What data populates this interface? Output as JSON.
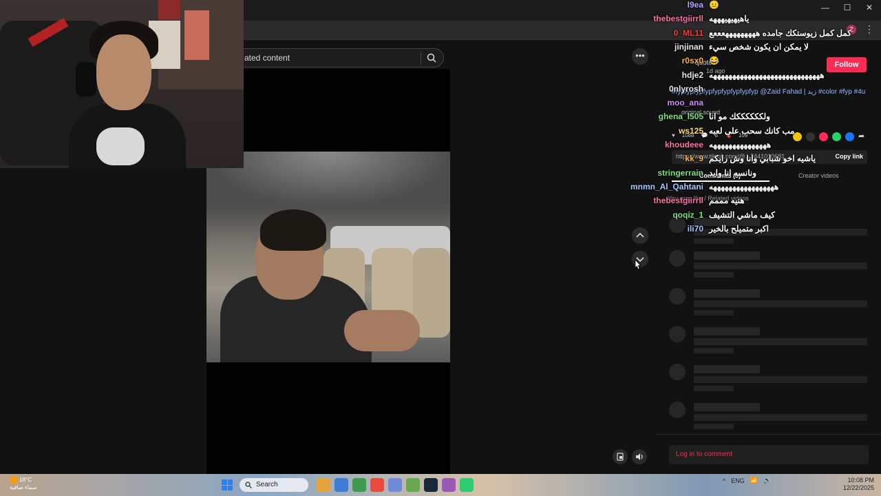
{
  "search": {
    "placeholder_text": "ated content"
  },
  "window": {
    "minimize": "—",
    "maximize": "☐",
    "close": "✕",
    "profile_badge": "Z"
  },
  "panel": {
    "follow_label": "Follow",
    "author_line": "quote",
    "time_line": "1d ago",
    "caption": "#fypfypfypfypfypfypfypfypfyp @Zaid Fahad | زيد #color #fyp #4u",
    "sound": "original sound",
    "likes": "1088",
    "comments_count": "8",
    "saves": "159",
    "copy_url": "https://www.tiktok.com/@...7441030681...",
    "copy_label": "Copy link",
    "tab_comments": "Comments (8)",
    "tab_creator": "Creator videos",
    "related_label": "You may like / Related videos",
    "login_label": "Log in to comment"
  },
  "chat": [
    {
      "user": "l9ea",
      "msg": "😐",
      "color": "#b9a5ff"
    },
    {
      "user": "thebestgiirrll",
      "msg": "ياهيهيهيهههه",
      "color": "#ff6fa8"
    },
    {
      "user": "0_ML11",
      "msg": "كمل كمل زيوستكك جامده هههههههههعععع",
      "color": "#ff3b3b"
    },
    {
      "user": "jinjinan",
      "msg": "لا يمكن ان يكون شخص سيء",
      "color": "#e8e8e8"
    },
    {
      "user": "r0sx0",
      "msg": "😂",
      "color": "#ffb347"
    },
    {
      "user": "hdje2",
      "msg": "هههههههههههههههههههههههههههههه",
      "color": "#e8e8e8"
    },
    {
      "user": "0nlyrosh",
      "msg": "",
      "color": "#e8e8e8"
    },
    {
      "user": "moo_ana",
      "msg": "",
      "color": "#d08bff"
    },
    {
      "user": "ghena_l505",
      "msg": "ولككككككك مو انا",
      "color": "#7ee07e"
    },
    {
      "user": "ws125",
      "msg": "مب كانك سحب على لعبه",
      "color": "#ffe066"
    },
    {
      "user": "khoudeee",
      "msg": "هههههههههههههههه",
      "color": "#ff6fa8"
    },
    {
      "user": "kk_9",
      "msg": "ياشيه اخو شبابي وانا وش رايكم",
      "color": "#ffb347"
    },
    {
      "user": "stringerrain",
      "msg": "ونانسه انا وايد",
      "color": "#7ee07e"
    },
    {
      "user": "mnmn_Al_Qahtani",
      "msg": "هههههههههههههههههه",
      "color": "#a9c7ff"
    },
    {
      "user": "thebestgiirrll",
      "msg": "هنيه مممم",
      "color": "#ff6fa8"
    },
    {
      "user": "qoqiz_1",
      "msg": "كيف ماشي التشيف",
      "color": "#7ee07e"
    },
    {
      "user": "ili70",
      "msg": "اكبر متميلح بالخير",
      "color": "#a9c7ff"
    }
  ],
  "taskbar": {
    "temp": "18°C",
    "weather_desc": "سماء صافية",
    "search_label": "Search",
    "lang": "ENG",
    "time": "10:08 PM",
    "date": "12/22/2025",
    "colors": [
      "#e8a33d",
      "#3a7bd5",
      "#3f9b4f",
      "#e74c3c",
      "#7289da",
      "#6aa84f",
      "#1b2838",
      "#9b59b6",
      "#2ecc71"
    ]
  }
}
